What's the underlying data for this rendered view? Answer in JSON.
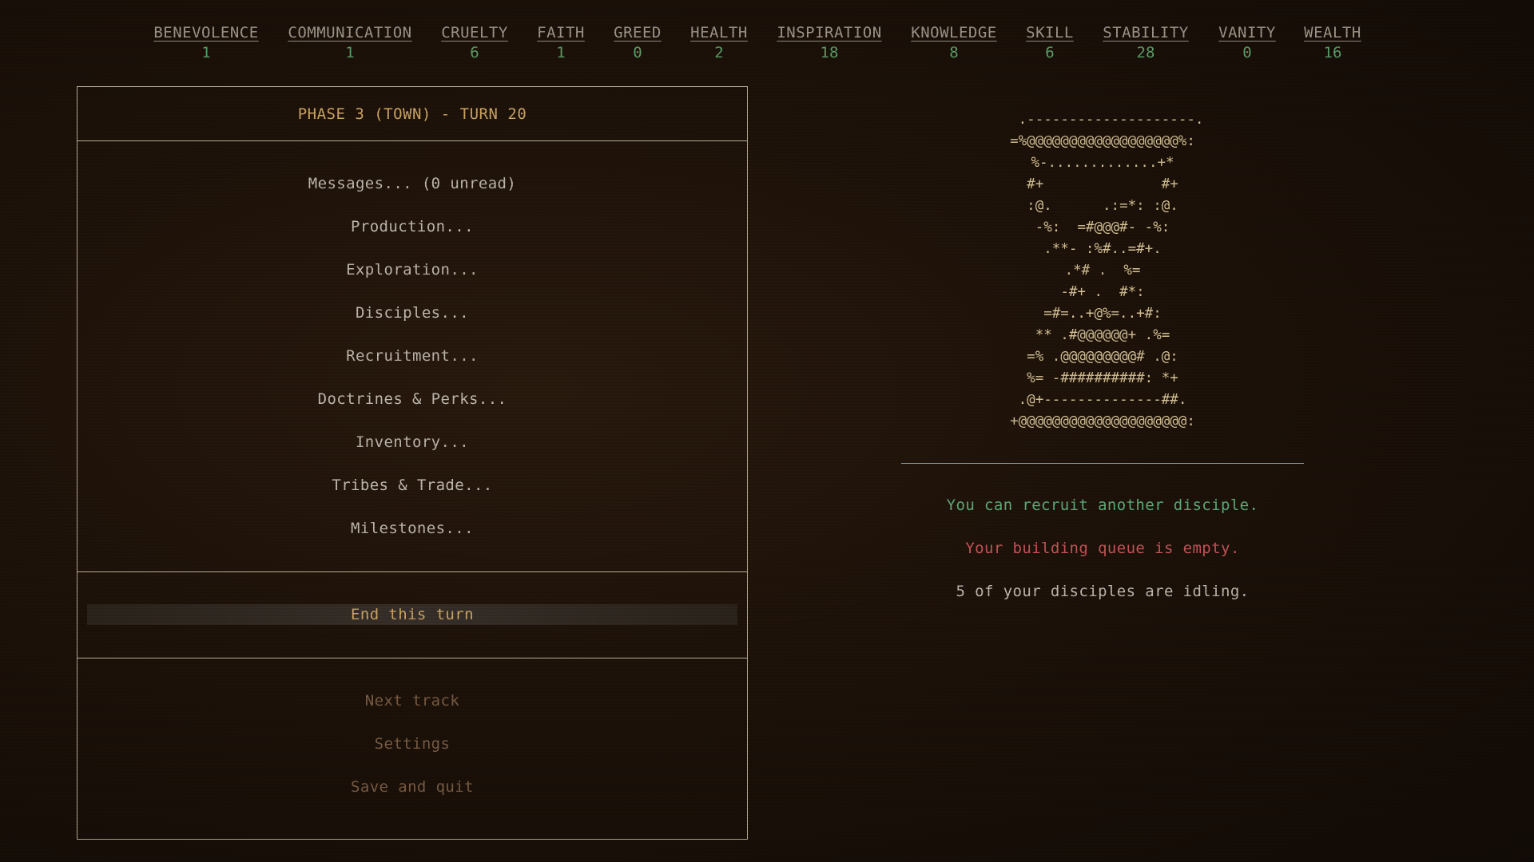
{
  "stats": [
    {
      "name": "BENEVOLENCE",
      "value": "1"
    },
    {
      "name": "COMMUNICATION",
      "value": "1"
    },
    {
      "name": "CRUELTY",
      "value": "6"
    },
    {
      "name": "FAITH",
      "value": "1"
    },
    {
      "name": "GREED",
      "value": "0"
    },
    {
      "name": "HEALTH",
      "value": "2"
    },
    {
      "name": "INSPIRATION",
      "value": "18"
    },
    {
      "name": "KNOWLEDGE",
      "value": "8"
    },
    {
      "name": "SKILL",
      "value": "6"
    },
    {
      "name": "STABILITY",
      "value": "28"
    },
    {
      "name": "VANITY",
      "value": "0"
    },
    {
      "name": "WEALTH",
      "value": "16"
    }
  ],
  "panel": {
    "title": "PHASE 3 (TOWN) - TURN 20",
    "menu": [
      "Messages... (0 unread)",
      "Production...",
      "Exploration...",
      "Disciples...",
      "Recruitment...",
      "Doctrines & Perks...",
      "Inventory...",
      "Tribes & Trade...",
      "Milestones..."
    ],
    "end_turn": "End this turn",
    "secondary": [
      "Next track",
      "Settings",
      "Save and quit"
    ]
  },
  "ascii_art": "  .--------------------.\n=%@@@@@@@@@@@@@@@@@@%:\n%-.............+*\n#+              #+\n:@.      .:=*: :@.\n-%:  =#@@@#- -%:\n.**- :%#..=#+.\n.*# .  %=\n-#+ .  #*:\n=#=..+@%=..+#:\n** .#@@@@@@+ .%=\n=% .@@@@@@@@@# .@:\n%= -##########: *+\n.@+--------------##.\n+@@@@@@@@@@@@@@@@@@@@:",
  "messages": [
    {
      "text": "You can recruit another disciple.",
      "color": "#5faf7a"
    },
    {
      "text": "Your building queue is empty.",
      "color": "#c8555a"
    },
    {
      "text": "5 of your disciples are idling.",
      "color": "#c2bbb0"
    }
  ],
  "colors": {
    "accent": "#d0a866",
    "stat_value": "#5fa06a",
    "border": "#b9ad95",
    "dim": "#7b5d44"
  }
}
